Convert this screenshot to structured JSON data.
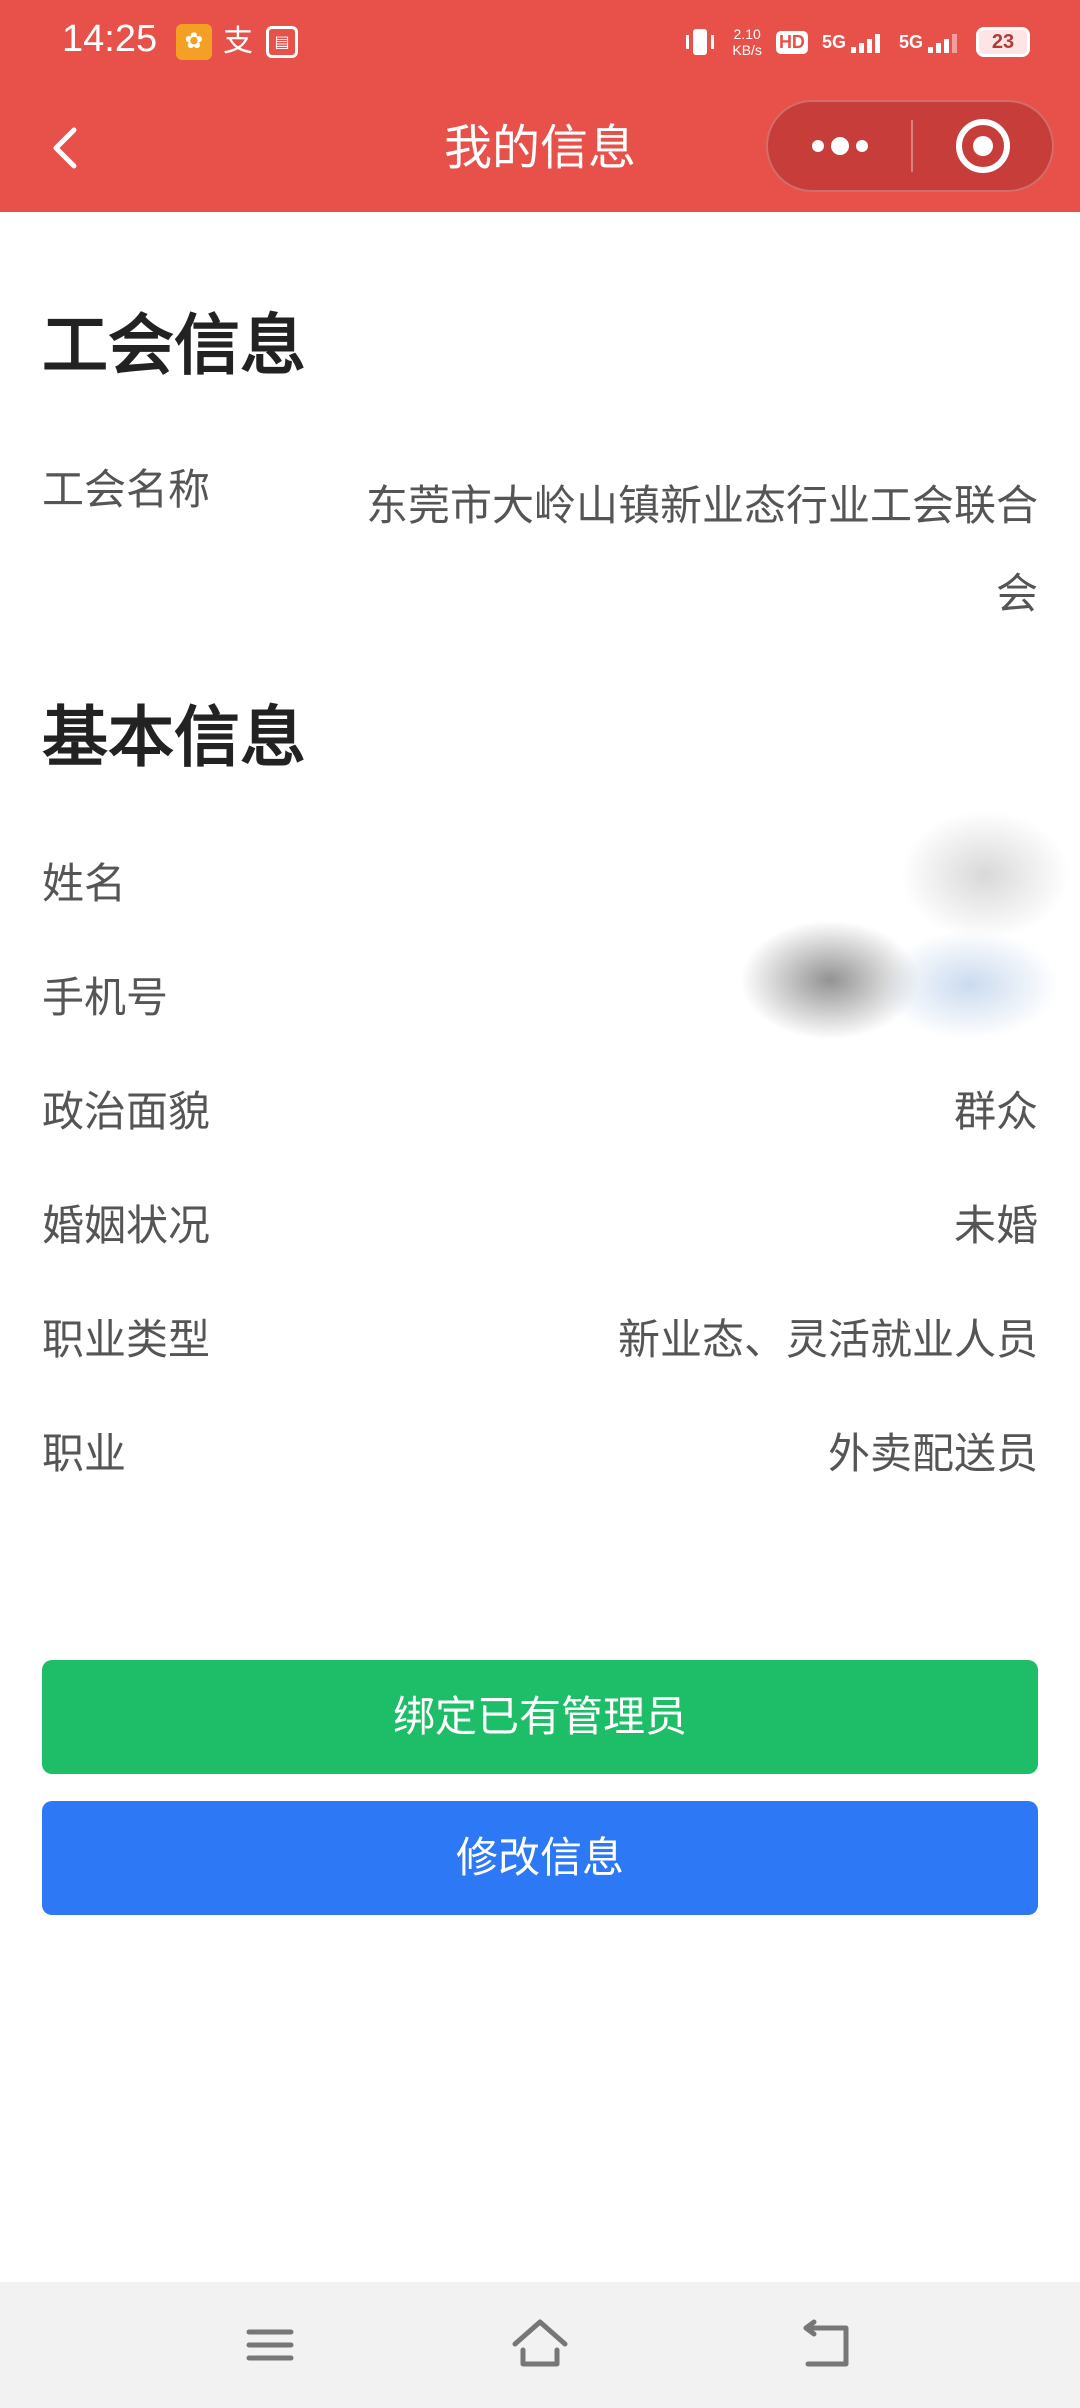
{
  "status_bar": {
    "time": "14:25",
    "net_speed_value": "2.10",
    "net_speed_unit": "KB/s",
    "hd_label": "HD",
    "sim1_label": "5G",
    "sim2_label": "5G",
    "battery": "23"
  },
  "nav": {
    "title": "我的信息"
  },
  "union_section": {
    "title": "工会信息",
    "name_label": "工会名称",
    "name_value": "东莞市大岭山镇新业态行业工会联合会"
  },
  "basic_section": {
    "title": "基本信息",
    "rows": [
      {
        "label": "姓名",
        "value": ""
      },
      {
        "label": "手机号",
        "value": ""
      },
      {
        "label": "政治面貌",
        "value": "群众"
      },
      {
        "label": "婚姻状况",
        "value": "未婚"
      },
      {
        "label": "职业类型",
        "value": "新业态、灵活就业人员"
      },
      {
        "label": "职业",
        "value": "外卖配送员"
      }
    ]
  },
  "buttons": {
    "bind_admin": "绑定已有管理员",
    "edit_info": "修改信息"
  },
  "colors": {
    "header": "#e8504a",
    "bind_button": "#1ebe68",
    "edit_button": "#2d78f4"
  }
}
